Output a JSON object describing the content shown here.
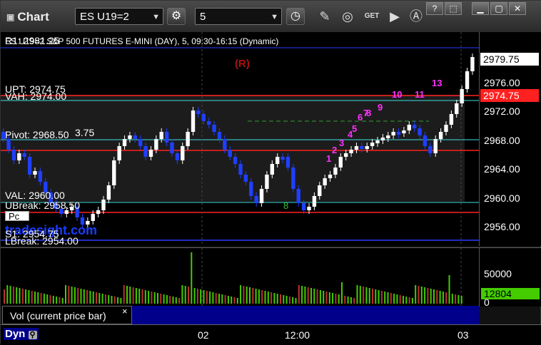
{
  "app": {
    "title": "Chart"
  },
  "toolbar": {
    "symbol": "ES U19=2",
    "interval": "5",
    "get_label": "GET"
  },
  "window_buttons": [
    "?",
    "⬚",
    "▁",
    "▢",
    "✕"
  ],
  "chart": {
    "header": "ES U19=2 S&P 500 FUTURES E-MINI (DAY), 5, 09:30-16:15 (Dynamic)",
    "marker_r": "(R)",
    "watermark": "tradesight.com",
    "levels": {
      "r1": "R1: 2981.25",
      "upt": "UPT: 2974.75",
      "vah": "VAH: 2974.00",
      "pivot": "Pivot: 2968.50",
      "pivot_extra": "3.75",
      "val": "VAL: 2960.00",
      "ubreak": "UBreak: 2958.50",
      "pc": "Pc",
      "s1": "S1: 2954.75",
      "lbreak": "LBreak: 2954.00"
    },
    "price_ticks": [
      "2976.00",
      "2972.00",
      "2968.00",
      "2964.00",
      "2960.00",
      "2956.00"
    ],
    "last_price": "2979.75",
    "red_tag": "2974.75",
    "counts_magenta": [
      "1",
      "2",
      "3",
      "4",
      "5",
      "6",
      "7",
      "8",
      "9",
      "10",
      "11",
      "13"
    ],
    "counts_green": [
      "8"
    ]
  },
  "volume": {
    "tick_50000": "50000",
    "tick_0": "0",
    "current": "12804",
    "legend": "Vol (current price bar)",
    "close": "×"
  },
  "time_axis": {
    "mode": "Dyn",
    "labels": [
      "02",
      "12:00",
      "03"
    ]
  },
  "colors": {
    "up": "#ffffff",
    "down": "#1f3fff",
    "red_level": "#ff2020",
    "cyan_level": "#40e0e0",
    "magenta": "#ff30ff",
    "green_count": "#30c030",
    "vol_green": "#44cc00"
  }
}
